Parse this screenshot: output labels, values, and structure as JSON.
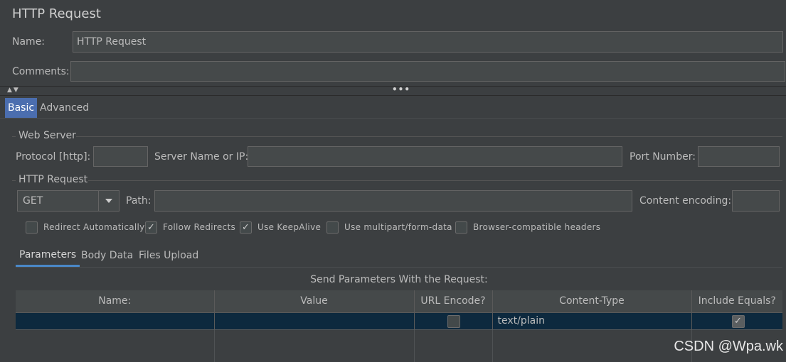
{
  "window": {
    "title": "HTTP Request"
  },
  "name_field": {
    "label": "Name:",
    "value": "HTTP Request"
  },
  "comments_field": {
    "label": "Comments:",
    "value": ""
  },
  "main_tabs": [
    {
      "label": "Basic",
      "active": true
    },
    {
      "label": "Advanced",
      "active": false
    }
  ],
  "web_server": {
    "group_title": "Web Server",
    "protocol_label": "Protocol [http]:",
    "protocol_value": "",
    "server_label": "Server Name or IP:",
    "server_value": "",
    "port_label": "Port Number:",
    "port_value": ""
  },
  "http_request": {
    "group_title": "HTTP Request",
    "method": "GET",
    "path_label": "Path:",
    "path_value": "",
    "encoding_label": "Content encoding:",
    "encoding_value": ""
  },
  "options": [
    {
      "label": "Redirect Automatically",
      "checked": false
    },
    {
      "label": "Follow Redirects",
      "checked": true
    },
    {
      "label": "Use KeepAlive",
      "checked": true
    },
    {
      "label": "Use multipart/form-data",
      "checked": false
    },
    {
      "label": "Browser-compatible headers",
      "checked": false
    }
  ],
  "sub_tabs": [
    {
      "label": "Parameters",
      "active": true
    },
    {
      "label": "Body Data",
      "active": false
    },
    {
      "label": "Files Upload",
      "active": false
    }
  ],
  "params_table": {
    "caption": "Send Parameters With the Request:",
    "headers": [
      "Name:",
      "Value",
      "URL Encode?",
      "Content-Type",
      "Include Equals?"
    ],
    "rows": [
      {
        "name": "",
        "value": "",
        "url_encode": false,
        "content_type": "text/plain",
        "include_equals": true
      }
    ]
  },
  "watermark": "CSDN @Wpa.wk",
  "colors": {
    "background": "#3c3f41",
    "field": "#45494a",
    "accent": "#4b6eaf",
    "selected_row": "#0d293e"
  }
}
